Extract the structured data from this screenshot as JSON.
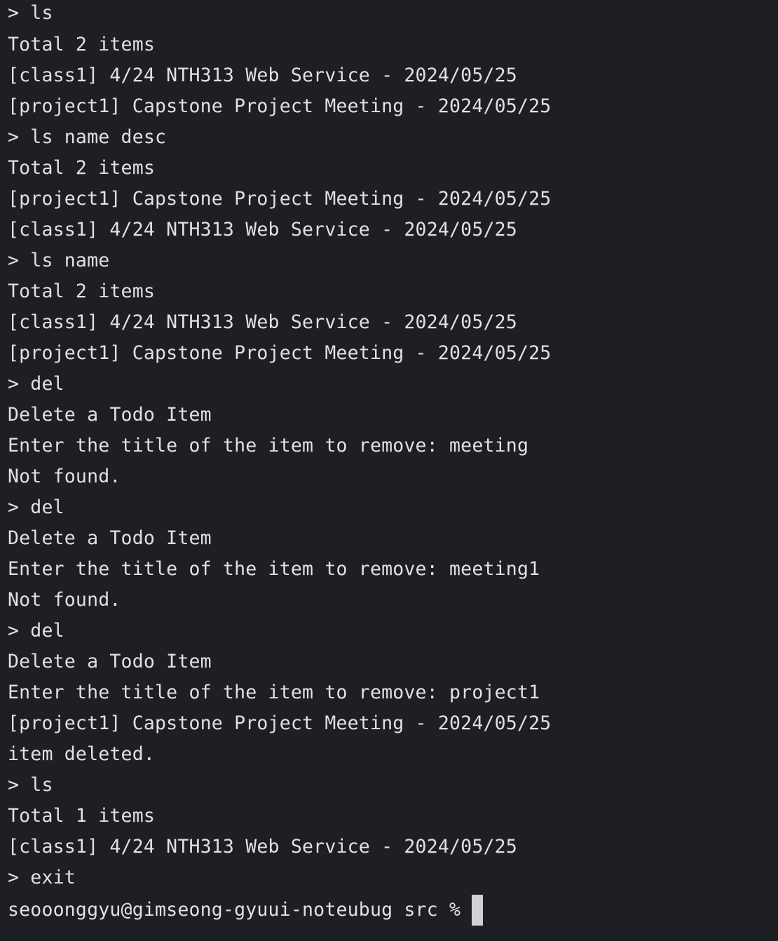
{
  "terminal": {
    "lines": [
      "> ls",
      "Total 2 items",
      "[class1] 4/24 NTH313 Web Service - 2024/05/25",
      "[project1] Capstone Project Meeting - 2024/05/25",
      "> ls name desc",
      "Total 2 items",
      "[project1] Capstone Project Meeting - 2024/05/25",
      "[class1] 4/24 NTH313 Web Service - 2024/05/25",
      "> ls name",
      "Total 2 items",
      "[class1] 4/24 NTH313 Web Service - 2024/05/25",
      "[project1] Capstone Project Meeting - 2024/05/25",
      "> del",
      "Delete a Todo Item",
      "Enter the title of the item to remove: meeting",
      "Not found.",
      "> del",
      "Delete a Todo Item",
      "Enter the title of the item to remove: meeting1",
      "Not found.",
      "> del",
      "Delete a Todo Item",
      "Enter the title of the item to remove: project1",
      "[project1] Capstone Project Meeting - 2024/05/25",
      "item deleted.",
      "> ls",
      "Total 1 items",
      "[class1] 4/24 NTH313 Web Service - 2024/05/25",
      "> exit"
    ],
    "shell_prompt": "seooonggyu@gimseong-gyuui-noteubug src %"
  },
  "colors": {
    "background": "#1e1f22",
    "text": "#dfe1e5",
    "cursor": "#cfd1d6"
  }
}
